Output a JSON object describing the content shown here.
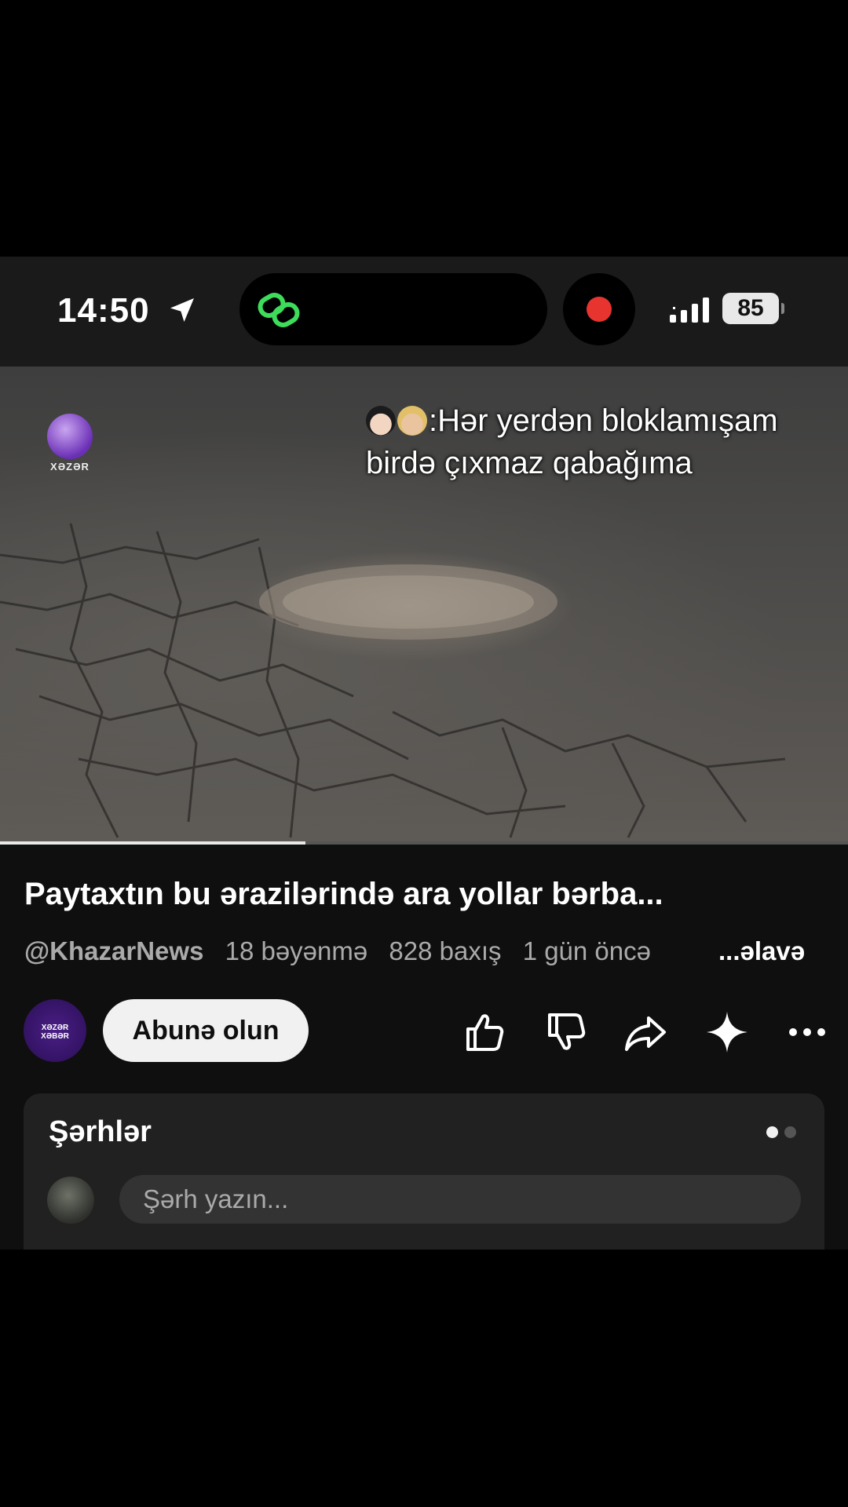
{
  "status_bar": {
    "time": "14:50",
    "battery": "85",
    "icons": [
      "location-arrow-icon",
      "link-icon",
      "record-icon",
      "signal-icon",
      "battery-icon"
    ],
    "record_color": "#e8342f",
    "link_color": "#3ddc5a"
  },
  "video": {
    "watermark_logo": "XƏZƏR",
    "overlay_line1": ":Hər yerdən bloklamışam",
    "overlay_line2": "birdə çıxmaz qabağıma",
    "progress": 0.36
  },
  "info": {
    "title": "Paytaxtın bu ərazilərində ara yollar bərba...",
    "channel": "@KhazarNews",
    "likes": "18 bəyənmə",
    "views": "828 baxış",
    "age": "1 gün öncə",
    "more": "...əlavə"
  },
  "actions": {
    "channel_avatar_text": "XƏZƏR XƏBƏR",
    "subscribe_label": "Abunə olun",
    "icons": [
      "like-icon",
      "dislike-icon",
      "share-icon",
      "remix-icon",
      "more-icon"
    ]
  },
  "comments": {
    "title": "Şərhlər",
    "placeholder": "Şərh yazın...",
    "pages": 2,
    "active_page": 1
  },
  "colors": {
    "background": "#0f0f0f",
    "card": "#212121",
    "brand_purple": "#6b2fb6"
  }
}
